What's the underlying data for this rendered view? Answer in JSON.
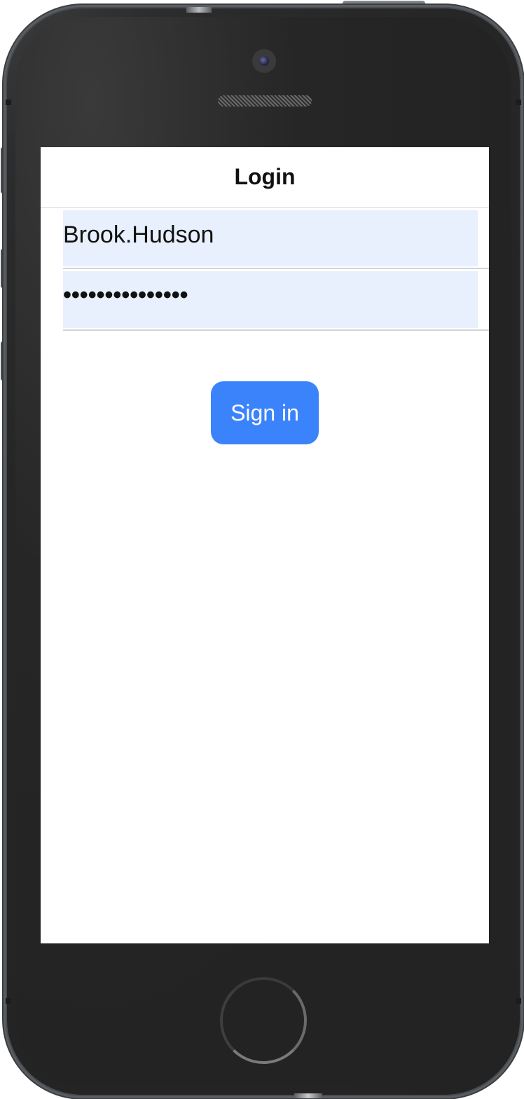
{
  "header": {
    "title": "Login"
  },
  "login_form": {
    "username_value": "Brook.Hudson",
    "password_masked": "•••••••••••••••",
    "signin_label": "Sign in"
  },
  "colors": {
    "accent": "#3b83fb",
    "field_background": "#e8f0fd",
    "phone_body": "#232323",
    "screen_background": "#ffffff"
  },
  "icons": {
    "camera": "front-camera-icon",
    "speaker": "speaker-grille-icon",
    "home": "home-button-icon"
  }
}
